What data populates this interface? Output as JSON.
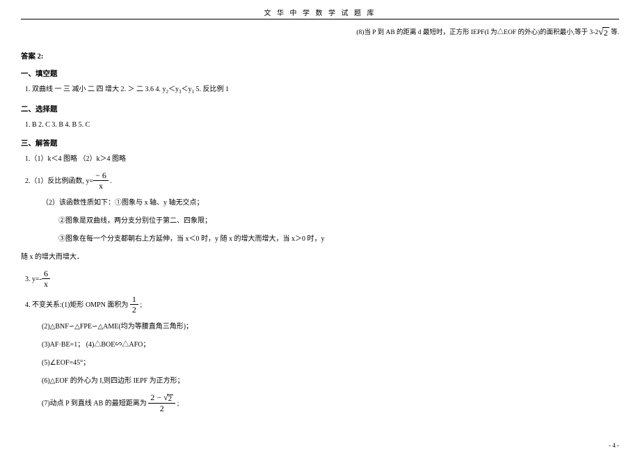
{
  "header": {
    "title": "文 华 中 学 数 学 试 题 库"
  },
  "top_note": {
    "prefix": "(8)当 P 到 AB 的距离 d 最短时，正方形 IEPF(I 为△EOF 的外心)的面积最小,等于 3-2",
    "sqrt_val": "2",
    "suffix": " 等."
  },
  "answer_label": "答案 2:",
  "s1": {
    "title": "一、填空题",
    "line1_a": "1. 双曲线  一   三   减小   二   四   增大   2. ＞   二   3.6   4. y",
    "line1_b": "＜y",
    "line1_c": "＜y",
    "line1_d": "   5. 反比例   1",
    "sub2": "2",
    "sub3": "3",
    "sub1": "1"
  },
  "s2": {
    "title": "二、选择题",
    "line": "1. B   2. C   3. B   4. B   5. C"
  },
  "s3": {
    "title": "三、解答题",
    "l1": "1.（1）k＜4   图略    （2）k＞4   图略",
    "l2_a": "2.（1）反比例函数, y=",
    "l2_num": "− 6",
    "l2_den": "x",
    "l2_b": " .",
    "l2_2": "（2）该函数性质如下：①图象与 x 轴、y 轴无交点；",
    "l2_2b": "②图象是双曲线，两分支分别位于第二、四象限；",
    "l2_2c": "③图象在每一个分支都朝右上方延伸，当 x＜0 时，y 随 x 的增大而增大，当 x＞0 时，y",
    "l2_2d": "随 x 的增大而增大．",
    "l3_a": "3. y=-",
    "l3_num": "6",
    "l3_den": "x",
    "l4_a": "4. 不变关系:(1)矩形 OMPN 面积为",
    "l4_num": "1",
    "l4_den": "2",
    "l4_b": " ;",
    "l4_2": "(2)△BNF∽△FPE∽△AME(均为等腰直角三角形)；",
    "l4_3": "(3)AF·BE=1； (4)△BOE∽△AFO；",
    "l4_5": "(5)∠EOF=45°；",
    "l4_6": "(6)△EOF 的外心为 I,则四边形 IEPF 为正方形；",
    "l4_7a": "(7)动点 P 到直线 AB 的最短距离为",
    "l4_7num_a": "2 − ",
    "l4_7num_sqrt": "2",
    "l4_7den": "2",
    "l4_7b": " ;"
  },
  "footer": {
    "page": "- 4 -"
  }
}
